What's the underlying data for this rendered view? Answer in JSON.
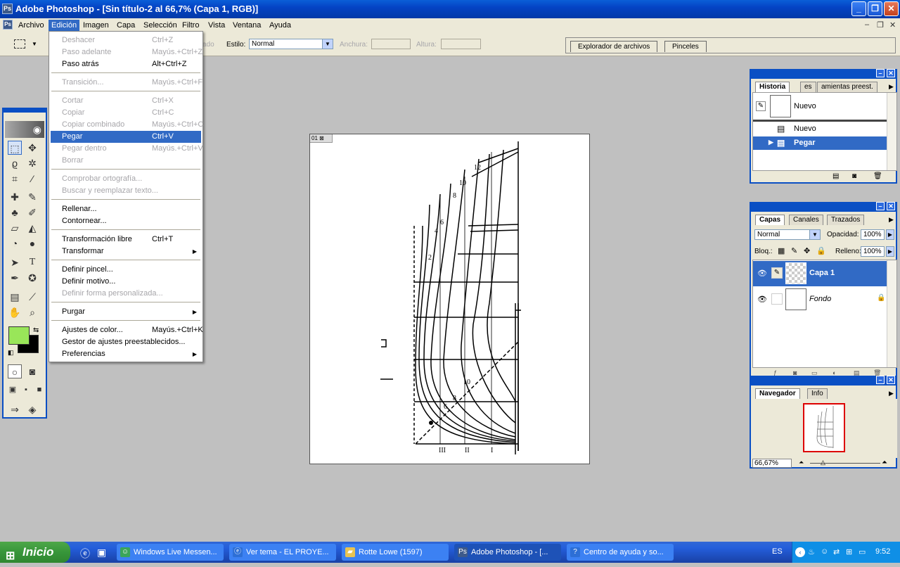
{
  "window": {
    "title": "Adobe Photoshop - [Sin título-2 al 66,7% (Capa 1, RGB)]",
    "app_icon": "photoshop-icon"
  },
  "menubar": {
    "items": [
      "Archivo",
      "Edición",
      "Imagen",
      "Capa",
      "Selección",
      "Filtro",
      "Vista",
      "Ventana",
      "Ayuda"
    ],
    "active": "Edición"
  },
  "options": {
    "hidden_text": "ado",
    "estilo_label": "Estilo:",
    "estilo_value": "Normal",
    "anchura_label": "Anchura:",
    "altura_label": "Altura:",
    "well_tabs": [
      "Explorador de archivos",
      "Pinceles"
    ]
  },
  "edit_menu": {
    "items": [
      {
        "label": "Deshacer",
        "shortcut": "Ctrl+Z",
        "disabled": true
      },
      {
        "label": "Paso adelante",
        "shortcut": "Mayús.+Ctrl+Z",
        "disabled": true
      },
      {
        "label": "Paso atrás",
        "shortcut": "Alt+Ctrl+Z",
        "disabled": false
      },
      {
        "label": "Transición...",
        "shortcut": "Mayús.+Ctrl+F",
        "disabled": true
      },
      {
        "label": "Cortar",
        "shortcut": "Ctrl+X",
        "disabled": true
      },
      {
        "label": "Copiar",
        "shortcut": "Ctrl+C",
        "disabled": true
      },
      {
        "label": "Copiar combinado",
        "shortcut": "Mayús.+Ctrl+C",
        "disabled": true
      },
      {
        "label": "Pegar",
        "shortcut": "Ctrl+V",
        "disabled": false,
        "highlighted": true
      },
      {
        "label": "Pegar dentro",
        "shortcut": "Mayús.+Ctrl+V",
        "disabled": true
      },
      {
        "label": "Borrar",
        "shortcut": "",
        "disabled": true
      },
      {
        "label": "Comprobar ortografía...",
        "shortcut": "",
        "disabled": true
      },
      {
        "label": "Buscar y reemplazar texto...",
        "shortcut": "",
        "disabled": true
      },
      {
        "label": "Rellenar...",
        "shortcut": "",
        "disabled": false
      },
      {
        "label": "Contornear...",
        "shortcut": "",
        "disabled": false
      },
      {
        "label": "Transformación libre",
        "shortcut": "Ctrl+T",
        "disabled": false
      },
      {
        "label": "Transformar",
        "shortcut": "",
        "disabled": false,
        "submenu": true
      },
      {
        "label": "Definir pincel...",
        "shortcut": "",
        "disabled": false
      },
      {
        "label": "Definir motivo...",
        "shortcut": "",
        "disabled": false
      },
      {
        "label": "Definir forma personalizada...",
        "shortcut": "",
        "disabled": true
      },
      {
        "label": "Purgar",
        "shortcut": "",
        "disabled": false,
        "submenu": true
      },
      {
        "label": "Ajustes de color...",
        "shortcut": "Mayús.+Ctrl+K",
        "disabled": false
      },
      {
        "label": "Gestor de ajustes preestablecidos...",
        "shortcut": "",
        "disabled": false
      },
      {
        "label": "Preferencias",
        "shortcut": "",
        "disabled": false,
        "submenu": true
      }
    ]
  },
  "document": {
    "tab_label": "01"
  },
  "history_panel": {
    "tabs": [
      "Historia",
      "es",
      "amientas preest."
    ],
    "snapshot_label": "Nuevo",
    "steps": [
      "Nuevo",
      "Pegar"
    ],
    "selected_step": "Pegar"
  },
  "layers_panel": {
    "tabs": [
      "Capas",
      "Canales",
      "Trazados"
    ],
    "blend_mode": "Normal",
    "opacity_label": "Opacidad:",
    "opacity_value": "100%",
    "lock_label": "Bloq.:",
    "fill_label": "Relleno:",
    "fill_value": "100%",
    "layers": [
      {
        "name": "Capa 1",
        "selected": true,
        "visible": true
      },
      {
        "name": "Fondo",
        "selected": false,
        "visible": true,
        "locked": true
      }
    ]
  },
  "navigator_panel": {
    "tabs": [
      "Navegador",
      "Info"
    ],
    "zoom": "66,67%"
  },
  "taskbar": {
    "start_label": "Inicio",
    "tasks": [
      {
        "label": "Windows Live Messen...",
        "icon": "messenger-icon"
      },
      {
        "label": "Ver tema - EL PROYE...",
        "icon": "browser-icon"
      },
      {
        "label": "Rotte Lowe  (1597)",
        "icon": "folder-icon"
      },
      {
        "label": "Adobe Photoshop - [...",
        "icon": "photoshop-icon",
        "active": true
      },
      {
        "label": "Centro de ayuda y so...",
        "icon": "help-icon"
      }
    ],
    "language": "ES",
    "clock": "9:52"
  },
  "colors": {
    "foreground": "#99e659",
    "background": "#000000",
    "accent": "#316ac5",
    "titlebar": "#0a4fc4"
  }
}
